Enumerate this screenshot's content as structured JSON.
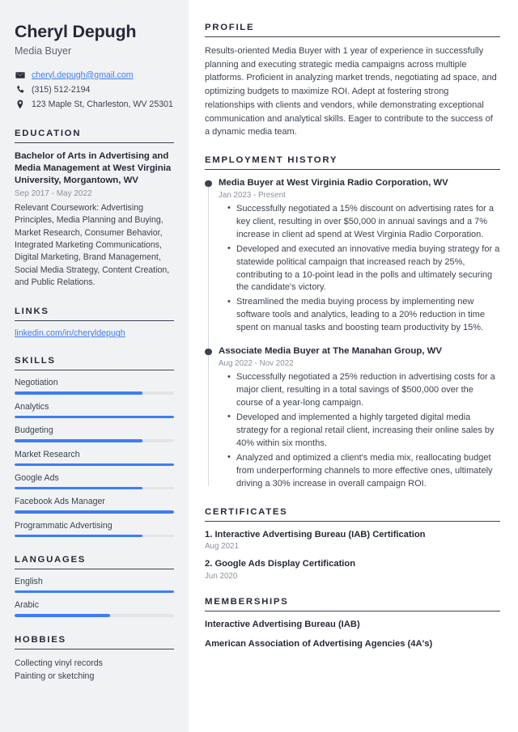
{
  "sidebar": {
    "name": "Cheryl Depugh",
    "job_title": "Media Buyer",
    "contact": {
      "email": "cheryl.depugh@gmail.com",
      "phone": "(315) 512-2194",
      "address": "123 Maple St, Charleston, WV 25301"
    },
    "education": {
      "heading": "EDUCATION",
      "degree": "Bachelor of Arts in Advertising and Media Management at West Virginia University, Morgantown, WV",
      "date": "Sep 2017 - May 2022",
      "description": "Relevant Coursework: Advertising Principles, Media Planning and Buying, Market Research, Consumer Behavior, Integrated Marketing Communications, Digital Marketing, Brand Management, Social Media Strategy, Content Creation, and Public Relations."
    },
    "links": {
      "heading": "LINKS",
      "items": [
        {
          "label": "linkedin.com/in/cheryldepugh"
        }
      ]
    },
    "skills": {
      "heading": "SKILLS",
      "items": [
        {
          "label": "Negotiation",
          "level": 80
        },
        {
          "label": "Analytics",
          "level": 100
        },
        {
          "label": "Budgeting",
          "level": 80
        },
        {
          "label": "Market Research",
          "level": 100
        },
        {
          "label": "Google Ads",
          "level": 80
        },
        {
          "label": "Facebook Ads Manager",
          "level": 100
        },
        {
          "label": "Programmatic Advertising",
          "level": 80
        }
      ]
    },
    "languages": {
      "heading": "LANGUAGES",
      "items": [
        {
          "label": "English",
          "level": 100
        },
        {
          "label": "Arabic",
          "level": 60
        }
      ]
    },
    "hobbies": {
      "heading": "HOBBIES",
      "items": [
        {
          "label": "Collecting vinyl records"
        },
        {
          "label": "Painting or sketching"
        }
      ]
    }
  },
  "main": {
    "profile": {
      "heading": "PROFILE",
      "text": "Results-oriented Media Buyer with 1 year of experience in successfully planning and executing strategic media campaigns across multiple platforms. Proficient in analyzing market trends, negotiating ad space, and optimizing budgets to maximize ROI. Adept at fostering strong relationships with clients and vendors, while demonstrating exceptional communication and analytical skills. Eager to contribute to the success of a dynamic media team."
    },
    "employment": {
      "heading": "EMPLOYMENT HISTORY",
      "jobs": [
        {
          "title": "Media Buyer at West Virginia Radio Corporation, WV",
          "date": "Jan 2023 - Present",
          "bullets": [
            "Successfully negotiated a 15% discount on advertising rates for a key client, resulting in over $50,000 in annual savings and a 7% increase in client ad spend at West Virginia Radio Corporation.",
            "Developed and executed an innovative media buying strategy for a statewide political campaign that increased reach by 25%, contributing to a 10-point lead in the polls and ultimately securing the candidate's victory.",
            "Streamlined the media buying process by implementing new software tools and analytics, leading to a 20% reduction in time spent on manual tasks and boosting team productivity by 15%."
          ]
        },
        {
          "title": "Associate Media Buyer at The Manahan Group, WV",
          "date": "Aug 2022 - Nov 2022",
          "bullets": [
            "Successfully negotiated a 25% reduction in advertising costs for a major client, resulting in a total savings of $500,000 over the course of a year-long campaign.",
            "Developed and implemented a highly targeted digital media strategy for a regional retail client, increasing their online sales by 40% within six months.",
            "Analyzed and optimized a client's media mix, reallocating budget from underperforming channels to more effective ones, ultimately driving a 30% increase in overall campaign ROI."
          ]
        }
      ]
    },
    "certificates": {
      "heading": "CERTIFICATES",
      "items": [
        {
          "title": "1. Interactive Advertising Bureau (IAB) Certification",
          "date": "Aug 2021"
        },
        {
          "title": "2. Google Ads Display Certification",
          "date": "Jun 2020"
        }
      ]
    },
    "memberships": {
      "heading": "MEMBERSHIPS",
      "items": [
        {
          "label": "Interactive Advertising Bureau (IAB)"
        },
        {
          "label": "American Association of Advertising Agencies (4A's)"
        }
      ]
    }
  },
  "theme": {
    "accent": "#3d7df6",
    "sidebar_bg": "#f1f2f4",
    "heading_color": "#252a38",
    "muted_color": "#8b919c"
  }
}
